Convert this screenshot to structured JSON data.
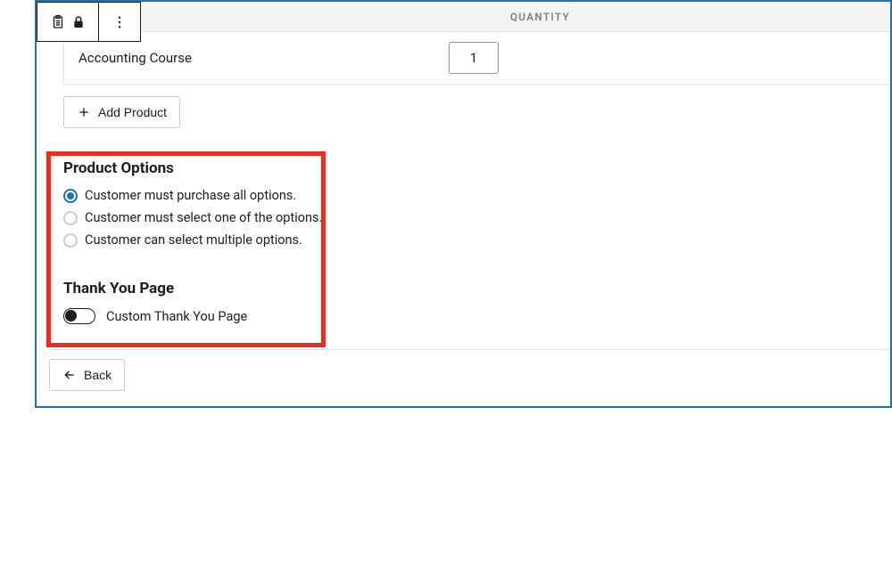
{
  "table": {
    "quantity_header": "QUANTITY",
    "product_name": "Accounting Course",
    "quantity_value": "1"
  },
  "add_product_label": "Add Product",
  "product_options": {
    "title": "Product Options",
    "opt_all": "Customer must purchase all options.",
    "opt_one": "Customer must select one of the options.",
    "opt_multi": "Customer can select multiple options."
  },
  "thank_you": {
    "title": "Thank You Page",
    "toggle_label": "Custom Thank You Page"
  },
  "back_label": "Back"
}
